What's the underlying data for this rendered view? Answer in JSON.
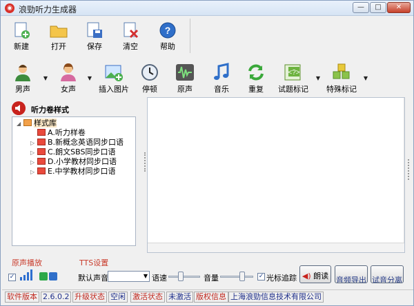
{
  "window": {
    "title": "浪勁听力生成器",
    "minimize": "—",
    "maximize": "□",
    "close": "✕"
  },
  "toolbar_main": [
    {
      "name": "new",
      "label": "新建",
      "icon": "new-document-icon"
    },
    {
      "name": "open",
      "label": "打开",
      "icon": "folder-open-icon"
    },
    {
      "name": "save",
      "label": "保存",
      "icon": "save-icon"
    },
    {
      "name": "clear",
      "label": "清空",
      "icon": "clear-icon"
    },
    {
      "name": "help",
      "label": "帮助",
      "icon": "help-icon"
    }
  ],
  "toolbar_insert": [
    {
      "name": "male-voice",
      "label": "男声",
      "icon": "male-user-icon",
      "dropdown": true
    },
    {
      "name": "female-voice",
      "label": "女声",
      "icon": "female-user-icon",
      "dropdown": true
    },
    {
      "name": "insert-image",
      "label": "插入图片",
      "icon": "image-icon",
      "dropdown": false
    },
    {
      "name": "pause",
      "label": "停顿",
      "icon": "clock-icon",
      "dropdown": false
    },
    {
      "name": "original-sound",
      "label": "原声",
      "icon": "waveform-icon",
      "dropdown": false
    },
    {
      "name": "music",
      "label": "音乐",
      "icon": "music-note-icon",
      "dropdown": false
    },
    {
      "name": "repeat",
      "label": "重复",
      "icon": "repeat-icon",
      "dropdown": false
    },
    {
      "name": "question-mark",
      "label": "试题标记",
      "icon": "question-tag-icon",
      "dropdown": true
    },
    {
      "name": "special-mark",
      "label": "特殊标记",
      "icon": "cubes-icon",
      "dropdown": true
    }
  ],
  "left_panel": {
    "title": "听力卷样式",
    "tree": {
      "root": "样式库",
      "items": [
        "A.听力样卷",
        "B.新概念英语同步口语",
        "C.朗文SBS同步口语",
        "D.小学教材同步口语",
        "E.中学教材同步口语"
      ]
    }
  },
  "bottom": {
    "original_play_label": "原声播放",
    "tts_label": "TTS设置",
    "default_voice_label": "默认声音",
    "default_voice_value": "",
    "speed_label": "语速",
    "volume_label": "音量",
    "cursor_track_label": "光标追踪",
    "read_button": "朗读",
    "export_button": "音频导出",
    "test_button": "试音分离"
  },
  "status_bar": {
    "version_label": "软件版本",
    "version_value": "2.6.0.2",
    "upgrade_label": "升级状态",
    "upgrade_value": "空闲",
    "activation_label": "激活状态",
    "activation_value": "未激活",
    "copyright_label": "版权信息",
    "company": "上海浪勁信息技术有限公司"
  }
}
